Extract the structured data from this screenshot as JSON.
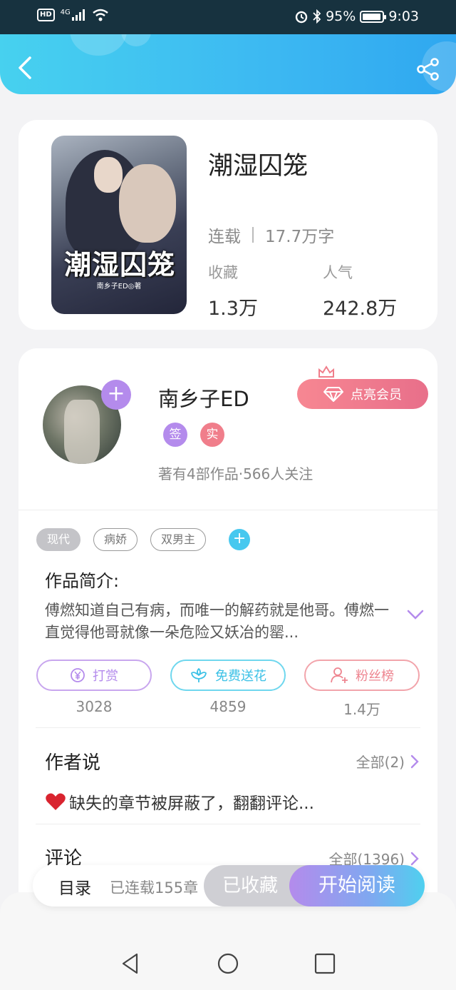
{
  "status_bar": {
    "network": "HD",
    "signal": "4G",
    "battery_percent": "95%",
    "battery_level": 0.95,
    "time": "9:03"
  },
  "header": {
    "back_icon": "chevron-left-icon",
    "share_icon": "share-icon"
  },
  "book": {
    "cover_title": "潮湿囚笼",
    "cover_author": "南乡子ED◎著",
    "title": "潮湿囚笼",
    "status": "连载",
    "word_count": "17.7万字",
    "favorites_label": "收藏",
    "favorites_value": "1.3万",
    "popularity_label": "人气",
    "popularity_value": "242.8万"
  },
  "author": {
    "name": "南乡子ED",
    "follow_button": "+",
    "vip_button_label": "点亮会员",
    "badge_signed": "签",
    "badge_verified": "实",
    "info": "著有4部作品·566人关注"
  },
  "tags": [
    "现代",
    "病娇",
    "双男主"
  ],
  "tag_add": "+",
  "intro": {
    "title": "作品简介:",
    "text": "傅燃知道自己有病，而唯一的解药就是他哥。傅燃一直觉得他哥就像一朵危险又妖冶的罂..."
  },
  "actions": [
    {
      "label": "打赏",
      "count": "3028",
      "icon": "yen-icon"
    },
    {
      "label": "免费送花",
      "count": "4859",
      "icon": "flower-icon"
    },
    {
      "label": "粉丝榜",
      "count": "1.4万",
      "icon": "user-icon"
    }
  ],
  "author_says": {
    "title": "作者说",
    "more": "全部(2)",
    "content": "缺失的章节被屏蔽了，翻翻评论..."
  },
  "comments": {
    "title": "评论",
    "more": "全部(1396)"
  },
  "bottom_bar": {
    "toc": "目录",
    "serial": "已连载155章",
    "collected": "已收藏",
    "read": "开始阅读"
  },
  "colors": {
    "header_start": "#47d1ef",
    "header_end": "#2fa7f0",
    "purple": "#b48bec",
    "pink": "#f07e8b",
    "cyan": "#3cc1e6"
  }
}
